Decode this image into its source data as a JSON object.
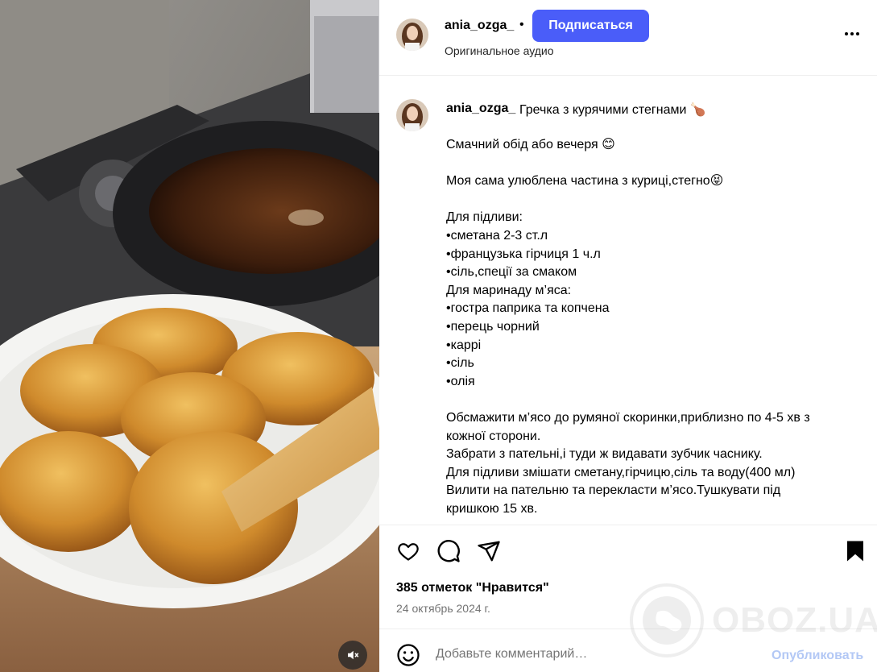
{
  "header": {
    "username": "ania_ozga_",
    "separator": "•",
    "follow_label": "Подписаться",
    "audio_label": "Оригинальное аудио"
  },
  "caption": {
    "username": "ania_ozga_",
    "title": "Гречка з курячими стегнами 🍗",
    "lines": [
      "Смачний обід або вечеря 😊",
      "",
      "Моя сама улюблена частина з курицi,стегно😝",
      "",
      "Для підливи:",
      "•сметана 2-3 ст.л",
      "•французька гірчиця 1 ч.л",
      "•сіль,спеції за смаком",
      "Для маринаду м’яса:",
      "•гостра паприка та копчена",
      "•перець чорний",
      "•каррі",
      "•сіль",
      "•олія",
      "",
      "Обсмажити м’ясо до румяної скоринки,приблизно по 4-5 хв з",
      "кожної сторони.",
      "Забрати з пательні,і туди ж видавати зубчик часнику.",
      "Для підливи змішати сметану,гірчицю,сіль та воду(400 мл)",
      "Вилити на пательню та перекласти м’ясо.Тушкувати під",
      "кришкою 15 хв."
    ]
  },
  "actions": {
    "likes": "385 отметок \"Нравится\"",
    "date": "24 октябрь 2024 г."
  },
  "comment": {
    "placeholder": "Добавьте комментарий…",
    "publish_label": "Опубликовать"
  },
  "watermark": {
    "text": "OBOZ.UA"
  },
  "colors": {
    "follow_button": "#4a5df9",
    "publish_disabled": "#b3c8f5",
    "secondary_text": "#737373"
  }
}
